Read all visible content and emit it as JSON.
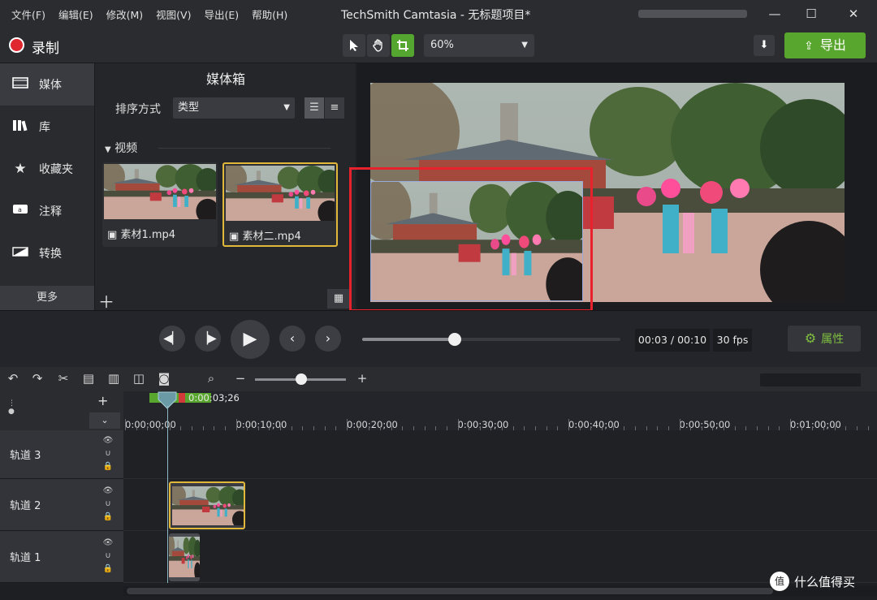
{
  "menu": [
    "文件(F)",
    "编辑(E)",
    "修改(M)",
    "视图(V)",
    "导出(E)",
    "帮助(H)"
  ],
  "window_title": "TechSmith Camtasia - 无标题项目*",
  "window_controls": {
    "minimize": "—",
    "maximize": "☐",
    "close": "✕"
  },
  "toolbar": {
    "record_label": "录制",
    "zoom_value": "60%",
    "export_label": "导出"
  },
  "nav": {
    "items": [
      {
        "label": "媒体",
        "icon": "media-icon"
      },
      {
        "label": "库",
        "icon": "library-icon"
      },
      {
        "label": "收藏夹",
        "icon": "star-icon"
      },
      {
        "label": "注释",
        "icon": "annotation-icon"
      },
      {
        "label": "转换",
        "icon": "transition-icon"
      }
    ],
    "more_label": "更多"
  },
  "media_bin": {
    "title": "媒体箱",
    "sort_label": "排序方式",
    "sort_value": "类型",
    "section_label": "视频",
    "items": [
      {
        "name": "素材1.mp4",
        "selected": false
      },
      {
        "name": "素材二.mp4",
        "selected": true
      }
    ]
  },
  "playback": {
    "current_time": "00:03",
    "separator": "/",
    "total_time": "00:10",
    "fps": "30 fps",
    "properties_label": "属性",
    "progress": 0.36
  },
  "timeline": {
    "playhead_time": "0:00:03;26",
    "ticks": [
      "0:00:00;00",
      "0:00:10;00",
      "0:00:20;00",
      "0:00:30;00",
      "0:00:40;00",
      "0:00:50;00",
      "0:01:00;00"
    ],
    "tracks": [
      {
        "name": "轨道 3"
      },
      {
        "name": "轨道 2"
      },
      {
        "name": "轨道 1"
      }
    ]
  },
  "watermark": {
    "logo": "值",
    "text": "什么值得买"
  },
  "colors": {
    "accent_green": "#58a62d",
    "record_red": "#e0262e",
    "selection_yellow": "#e2b83b",
    "highlight_red": "#e8222d"
  }
}
